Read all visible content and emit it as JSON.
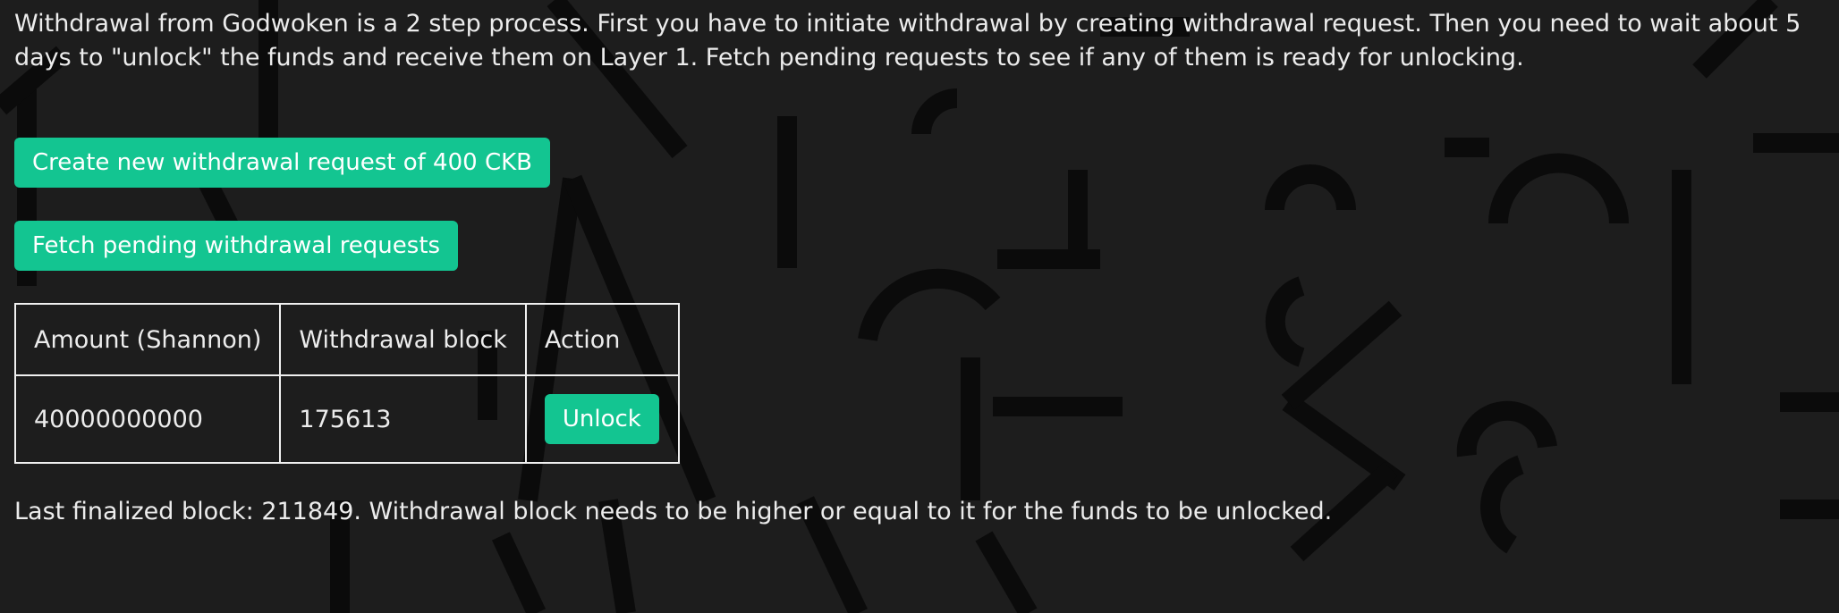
{
  "intro_text": "Withdrawal from Godwoken is a 2 step process. First you have to initiate withdrawal by creating withdrawal request. Then you need to wait about 5 days to \"unlock\" the funds and receive them on Layer 1. Fetch pending requests to see if any of them is ready for unlocking.",
  "actions": {
    "create_label": "Create new withdrawal request of 400 CKB",
    "fetch_label": "Fetch pending withdrawal requests"
  },
  "table": {
    "headers": {
      "amount": "Amount (Shannon)",
      "block": "Withdrawal block",
      "action": "Action"
    },
    "rows": [
      {
        "amount": "40000000000",
        "block": "175613",
        "action_label": "Unlock"
      }
    ]
  },
  "status_text": "Last finalized block: 211849. Withdrawal block needs to be higher or equal to it for the funds to be unlocked.",
  "colors": {
    "background": "#1d1d1d",
    "accent": "#13c591",
    "text": "#ececec"
  }
}
